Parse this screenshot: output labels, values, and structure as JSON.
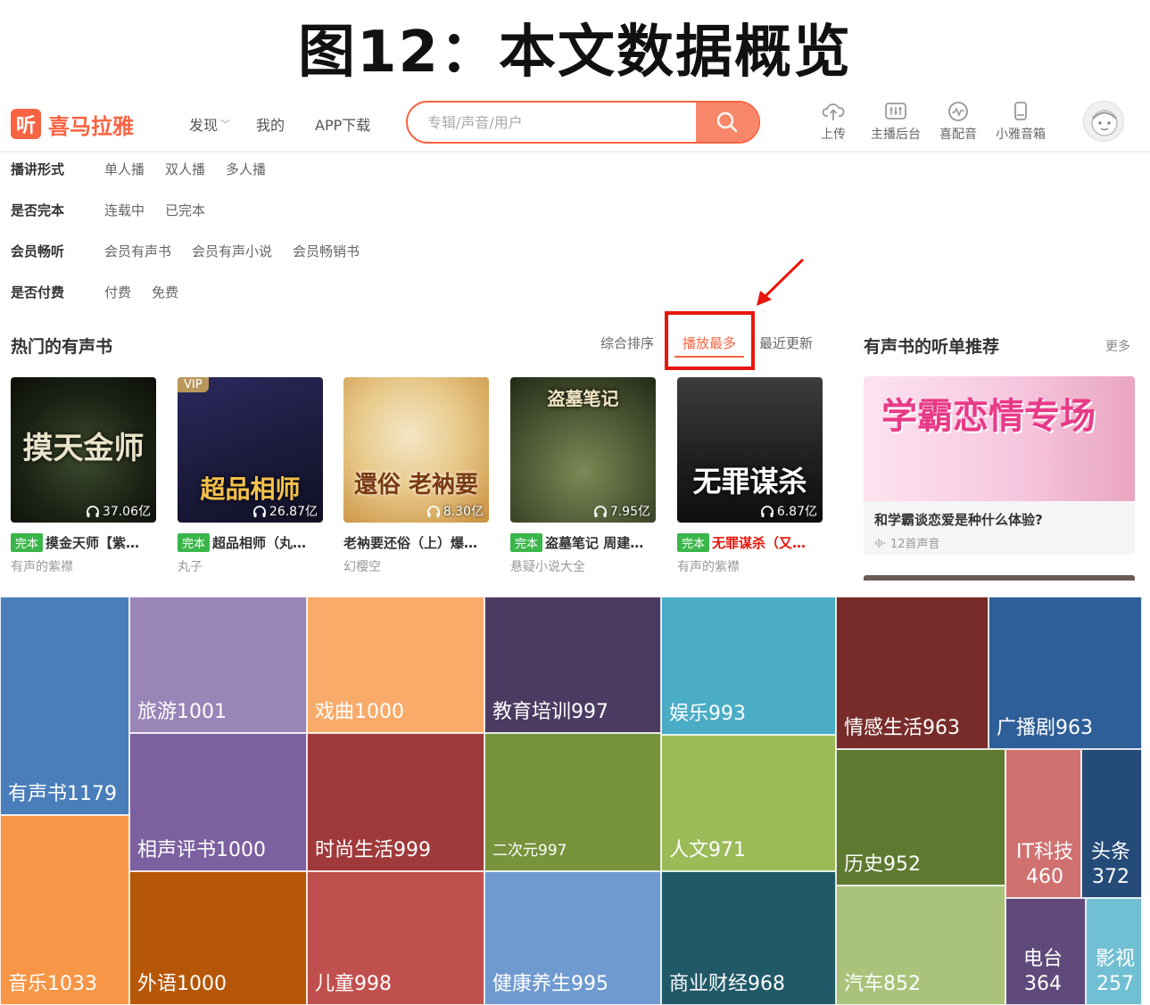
{
  "figure_title": "图12：本文数据概览",
  "header": {
    "logo_badge": "听",
    "logo_name": "喜马拉雅",
    "nav": [
      {
        "label": "发现",
        "has_dropdown": true
      },
      {
        "label": "我的",
        "has_dropdown": false
      },
      {
        "label": "APP下载",
        "has_dropdown": false
      }
    ],
    "search_placeholder": "专辑/声音/用户",
    "tools": [
      {
        "label": "上传",
        "icon": "upload-cloud-icon"
      },
      {
        "label": "主播后台",
        "icon": "mixer-icon"
      },
      {
        "label": "喜配音",
        "icon": "wave-circle-icon"
      },
      {
        "label": "小雅音箱",
        "icon": "speaker-icon"
      }
    ]
  },
  "filters": [
    {
      "label": "播讲形式",
      "options": [
        "单人播",
        "双人播",
        "多人播"
      ]
    },
    {
      "label": "是否完本",
      "options": [
        "连载中",
        "已完本"
      ]
    },
    {
      "label": "会员畅听",
      "options": [
        "会员有声书",
        "会员有声小说",
        "会员畅销书"
      ]
    },
    {
      "label": "是否付费",
      "options": [
        "付费",
        "免费"
      ]
    }
  ],
  "hot": {
    "title": "热门的有声书",
    "sorts": [
      "综合排序",
      "播放最多",
      "最近更新"
    ],
    "active_sort": "播放最多"
  },
  "books": [
    {
      "title": "摸金天师【紫…",
      "author": "有声的紫襟",
      "plays": "37.06亿",
      "tag": "完本",
      "vip": "",
      "cover_text": "摸天金师",
      "red_title": false
    },
    {
      "title": "超品相师（丸…",
      "author": "丸子",
      "plays": "26.87亿",
      "tag": "完本",
      "vip": "VIP",
      "cover_text": "超品相师",
      "red_title": false
    },
    {
      "title": "老衲要还俗（上）爆…",
      "author": "幻樱空",
      "plays": "8.30亿",
      "tag": "",
      "vip": "",
      "cover_text": "還俗 老衲要",
      "red_title": false
    },
    {
      "title": "盗墓笔记 周建…",
      "author": "悬疑小说大全",
      "plays": "7.95亿",
      "tag": "完本",
      "vip": "",
      "cover_text": "盗墓笔记",
      "red_title": false
    },
    {
      "title": "无罪谋杀（又…",
      "author": "有声的紫襟",
      "plays": "6.87亿",
      "tag": "完本",
      "vip": "",
      "cover_text": "无罪谋杀",
      "red_title": true
    }
  ],
  "recommend": {
    "title": "有声书的听单推荐",
    "more": "更多",
    "image_text": "学霸恋情专场",
    "card_title": "和学霸谈恋爱是种什么体验?",
    "card_meta": "12首声音"
  },
  "treemap": [
    {
      "label": "有声书1179",
      "color": "#4a7ebb"
    },
    {
      "label": "音乐1033",
      "color": "#f79646"
    },
    {
      "label": "旅游1001",
      "color": "#9a85b8"
    },
    {
      "label": "相声评书1000",
      "color": "#7d60a0"
    },
    {
      "label": "外语1000",
      "color": "#b65708"
    },
    {
      "label": "戏曲1000",
      "color": "#f9ab6a"
    },
    {
      "label": "时尚生活999",
      "color": "#a0393a"
    },
    {
      "label": "儿童998",
      "color": "#c0504d"
    },
    {
      "label": "教育培训997",
      "color": "#4b3b62"
    },
    {
      "label": "二次元997",
      "color": "#77933c"
    },
    {
      "label": "健康养生995",
      "color": "#6f9ad0"
    },
    {
      "label": "娱乐993",
      "color": "#4bacc6"
    },
    {
      "label": "人文971",
      "color": "#9bbb59"
    },
    {
      "label": "商业财经968",
      "color": "#215968"
    },
    {
      "label": "情感生活963",
      "color": "#772c2a"
    },
    {
      "label": "广播剧963",
      "color": "#2f5f98"
    },
    {
      "label": "历史952",
      "color": "#5e7a30"
    },
    {
      "label": "汽车852",
      "color": "#a9c37a"
    },
    {
      "label": "IT科技460",
      "color": "#d07170"
    },
    {
      "label": "头条372",
      "color": "#254b79"
    },
    {
      "label": "电台364",
      "color": "#604a7b"
    },
    {
      "label": "影视257",
      "color": "#71bfd3"
    }
  ]
}
